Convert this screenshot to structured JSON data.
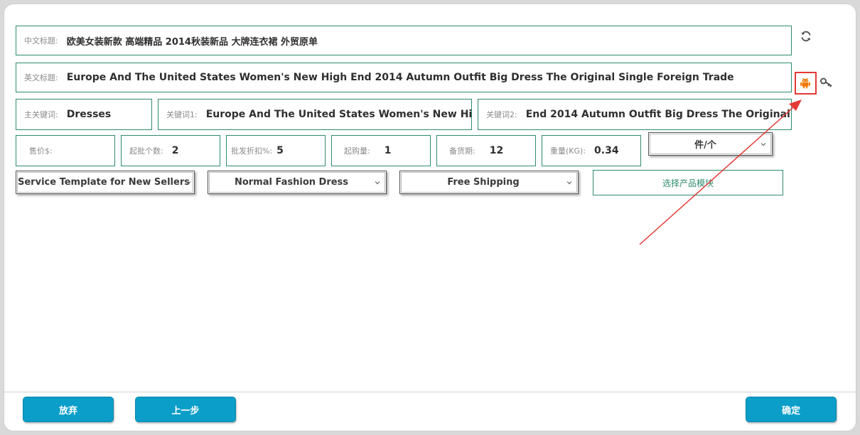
{
  "form": {
    "cn_title": {
      "label": "中文标题:",
      "value": "欧美女装新款 高端精品 2014秋装新品 大牌连衣裙 外贸原单"
    },
    "en_title": {
      "label": "英文标题:",
      "value": "Europe And The United States Women's New High End 2014 Autumn Outfit Big Dress The Original Single Foreign Trade"
    },
    "main_keyword": {
      "label": "主关键词:",
      "value": "Dresses"
    },
    "keyword1": {
      "label": "关键词1:",
      "value": "Europe And The United States Women's New High"
    },
    "keyword2": {
      "label": "关键词2:",
      "value": "End 2014 Autumn Outfit Big Dress The Original"
    },
    "price": {
      "label": "售价$:",
      "value": ""
    },
    "min_batch": {
      "label": "起批个数:",
      "value": "2"
    },
    "wholesale_discount": {
      "label": "批发折扣%:",
      "value": "5"
    },
    "min_order": {
      "label": "起购量:",
      "value": "1"
    },
    "stock_days": {
      "label": "备货期:",
      "value": "12"
    },
    "weight": {
      "label": "重量(KG):",
      "value": "0.34"
    },
    "unit_select": {
      "value": "件/个"
    },
    "service_template_select": {
      "value": "Service Template for New Sellers"
    },
    "category_select": {
      "value": "Normal Fashion Dress"
    },
    "shipping_select": {
      "value": "Free Shipping"
    },
    "product_template_button": {
      "label": "选择产品模块"
    }
  },
  "icons": {
    "refresh": "refresh-icon",
    "android": "android-icon",
    "key": "key-icon",
    "android_color": "#f07800"
  },
  "footer": {
    "discard_label": "放弃",
    "previous_label": "上一步",
    "confirm_label": "确定"
  },
  "colors": {
    "field_border": "#2e8b6e",
    "button_bg": "#0a9ec9",
    "annotation": "#e53935"
  }
}
